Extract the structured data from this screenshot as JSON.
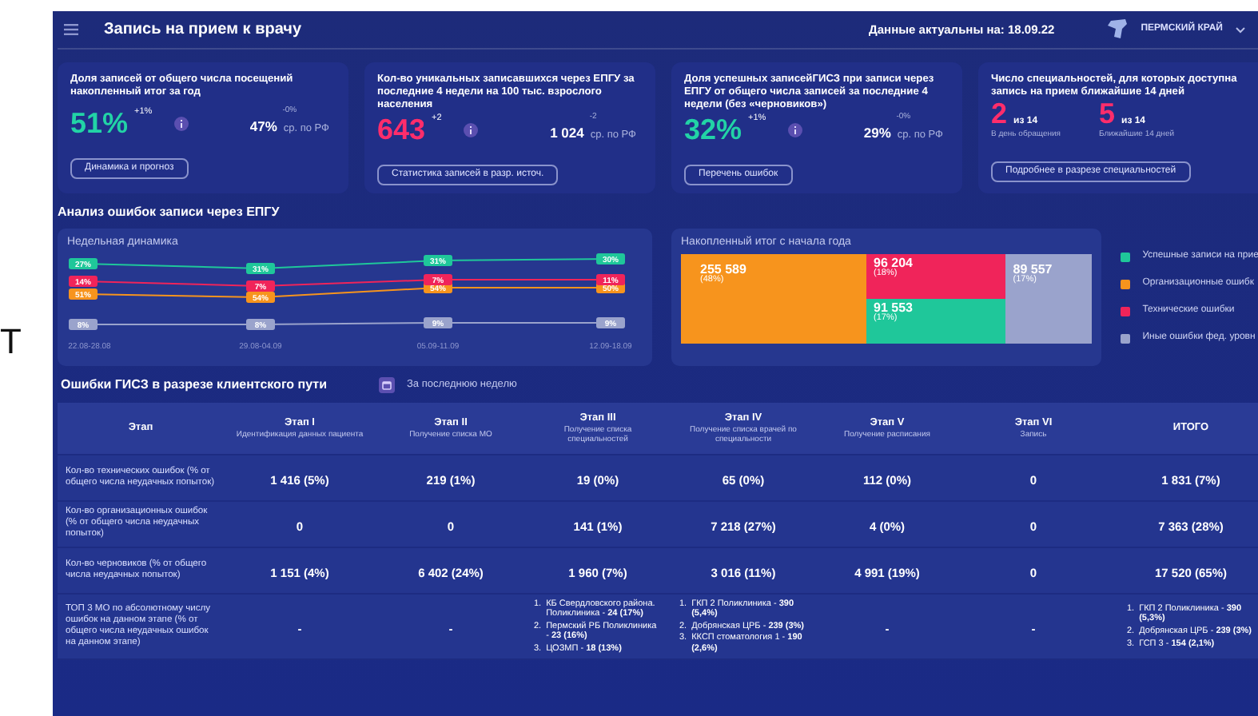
{
  "stray_text": "Т",
  "header": {
    "title": "Запись на прием к врачу",
    "updated": "Данные актуальны на: 18.09.22",
    "region": "ПЕРМСКИЙ КРАЙ"
  },
  "cards": [
    {
      "kind": "metric",
      "title": "Доля записей от общего числа посещений накопленный итог за год",
      "value": "51%",
      "color": "#22d3a6",
      "delta": "+1%",
      "rf_delta": "-0%",
      "rf_value": "47%",
      "rf_label": "ср. по РФ",
      "button": "Динамика и прогноз"
    },
    {
      "kind": "metric",
      "title": "Кол-во уникальных записавшихся через ЕПГУ за последние 4 недели на 100 тыс. взрослого населения",
      "value": "643",
      "color": "#ff2d6b",
      "delta": "+2",
      "rf_delta": "-2",
      "rf_value": "1 024",
      "rf_label": "ср. по РФ",
      "button": "Статистика записей в разр. источ."
    },
    {
      "kind": "metric",
      "title": "Доля успешных записейГИСЗ при записи через ЕПГУ от общего числа записей за последние 4 недели (без «черновиков»)",
      "value": "32%",
      "color": "#22d3a6",
      "delta": "+1%",
      "rf_delta": "-0%",
      "rf_value": "29%",
      "rf_label": "ср. по РФ",
      "button": "Перечень ошибок"
    },
    {
      "kind": "pair",
      "title": "Число специальностей, для которых доступна запись на прием ближайшие 14 дней",
      "items": [
        {
          "value": "2",
          "of": "из 14",
          "caption": "В день обращения",
          "color": "#ff2d6b"
        },
        {
          "value": "5",
          "of": "из 14",
          "caption": "Ближайшие 14 дней",
          "color": "#ff2d6b"
        }
      ],
      "button": "Подробнее в разрезе специальностей"
    }
  ],
  "analysis": {
    "title": "Анализ ошибок записи через ЕПГУ",
    "weekly": {
      "title": "Недельная динамика",
      "categories": [
        "22.08-28.08",
        "29.08-04.09",
        "05.09-11.09",
        "12.09-18.09"
      ],
      "series": [
        {
          "name": "Успешные записи на прие",
          "color": "#1fc79a",
          "labels": [
            "27%",
            "31%",
            "31%",
            "30%"
          ]
        },
        {
          "name": "Организационные ошибк",
          "color": "#f7941d",
          "labels": [
            "51%",
            "54%",
            "54%",
            "50%"
          ]
        },
        {
          "name": "Технические ошибки",
          "color": "#f0245a",
          "labels": [
            "14%",
            "7%",
            "7%",
            "11%"
          ]
        },
        {
          "name": "Иные ошибки фед. уровн",
          "color": "#9aa3cc",
          "labels": [
            "8%",
            "8%",
            "9%",
            "9%"
          ]
        }
      ]
    },
    "cumulative": {
      "title": "Накопленный итог с начала года",
      "tiles": [
        {
          "value": "255 589",
          "share": "(48%)",
          "color": "#f7941d"
        },
        {
          "value": "96 204",
          "share": "(18%)",
          "color": "#f0245a"
        },
        {
          "value": "91 553",
          "share": "(17%)",
          "color": "#1fc79a"
        },
        {
          "value": "89 557",
          "share": "(17%)",
          "color": "#9aa3cc"
        }
      ]
    }
  },
  "errors": {
    "title": "Ошибки ГИСЗ в разрезе клиентского пути",
    "period": "За последнюю неделю",
    "columns": [
      {
        "title": "Этап"
      },
      {
        "title": "Этап I",
        "subtitle": "Идентификация данных пациента"
      },
      {
        "title": "Этап II",
        "subtitle": "Получение списка МО"
      },
      {
        "title": "Этап III",
        "subtitle": "Получение списка специальностей"
      },
      {
        "title": "Этап IV",
        "subtitle": "Получение списка врачей по специальности"
      },
      {
        "title": "Этап V",
        "subtitle": "Получение расписания"
      },
      {
        "title": "Этап VI",
        "subtitle": "Запись"
      },
      {
        "title": "ИТОГО"
      }
    ],
    "rows": [
      {
        "cells": [
          "Кол-во технических ошибок (% от общего числа неудачных попыток)",
          "1 416 (5%)",
          "219 (1%)",
          "19 (0%)",
          "65 (0%)",
          "112 (0%)",
          "0",
          "1 831 (7%)"
        ]
      },
      {
        "cells": [
          "Кол-во организационных ошибок (% от общего числа неудачных попыток)",
          "0",
          "0",
          "141 (1%)",
          "7 218 (27%)",
          "4 (0%)",
          "0",
          "7 363 (28%)"
        ]
      },
      {
        "cells": [
          "Кол-во черновиков (% от общего числа неудачных попыток)",
          "1 151 (4%)",
          "6 402 (24%)",
          "1 960 (7%)",
          "3 016 (11%)",
          "4 991 (19%)",
          "0",
          "17 520 (65%)"
        ]
      },
      {
        "cells": [
          "ТОП 3 МО по абсолютному числу ошибок на данном этапе (% от общего числа неудачных ошибок на данном этапе)",
          "-",
          "-",
          [
            {
              "n": "1.",
              "text": "КБ Свердловского района. Поликлиника - **24 (17%)**"
            },
            {
              "n": "2.",
              "text": "Пермский РБ Поликлиника - **23 (16%)**"
            },
            {
              "n": "3.",
              "text": "ЦОЗМП - **18 (13%)**"
            }
          ],
          [
            {
              "n": "1.",
              "text": "ГКП 2 Поликлиника - **390 (5,4%)**"
            },
            {
              "n": "2.",
              "text": "Добрянская ЦРБ - **239 (3%)**"
            },
            {
              "n": "3.",
              "text": "ККСП стоматология 1 - **190 (2,6%)**"
            }
          ],
          "-",
          "-",
          [
            {
              "n": "1.",
              "text": "ГКП 2 Поликлиника - **390 (5,3%)**"
            },
            {
              "n": "2.",
              "text": "Добрянская ЦРБ - **239 (3%)**"
            },
            {
              "n": "3.",
              "text": "ГСП 3 - **154 (2,1%)**"
            }
          ]
        ]
      }
    ]
  }
}
